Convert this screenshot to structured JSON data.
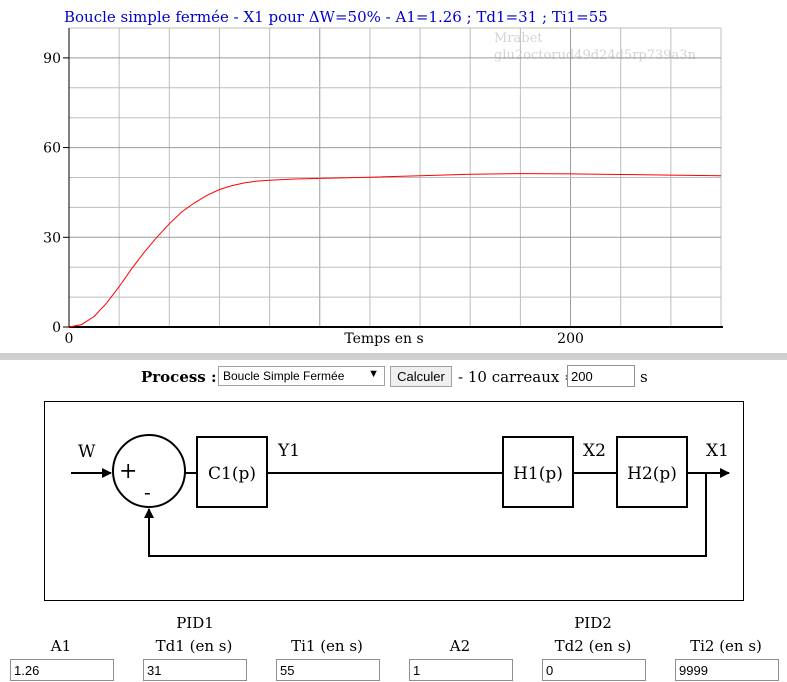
{
  "plot": {
    "title": "Boucle simple fermée - X1 pour ΔW=50% - A1=1.26 ; Td1=31 ; Ti1=55",
    "watermark_line1": "Mrabet",
    "watermark_line2": "glu2octorud49d24d5rp739a3n",
    "x_axis_label": "Temps en s"
  },
  "chart_data": {
    "type": "line",
    "xlim": [
      0,
      260
    ],
    "ylim": [
      0,
      100
    ],
    "x_ticks": [
      0,
      200
    ],
    "x_tick_labels": [
      "0",
      "200"
    ],
    "y_ticks": [
      0,
      30,
      60,
      90
    ],
    "y_tick_labels": [
      "0",
      "30",
      "60",
      "90"
    ],
    "grid": true,
    "xlabel": "Temps en s",
    "series": [
      {
        "color": "#ff0000",
        "x": [
          0,
          5,
          10,
          15,
          20,
          25,
          30,
          35,
          40,
          45,
          50,
          55,
          60,
          65,
          70,
          75,
          80,
          90,
          100,
          120,
          140,
          160,
          180,
          200,
          220,
          240,
          260
        ],
        "y": [
          0,
          0.8,
          3.5,
          8,
          13.5,
          19.5,
          25,
          30,
          34.5,
          38.5,
          41.5,
          44,
          46,
          47.3,
          48.2,
          48.8,
          49.1,
          49.5,
          49.7,
          50.1,
          50.6,
          51.1,
          51.3,
          51.2,
          51.0,
          50.8,
          50.6
        ]
      }
    ]
  },
  "process": {
    "label": "Process :",
    "select_value": "Boucle Simple Fermée",
    "calc_button": "Calculer",
    "carreaux_text": "- 10 carreaux =",
    "span_value": "200",
    "unit": "s"
  },
  "diagram": {
    "W": "W",
    "plus": "+",
    "minus": "-",
    "Y1": "Y1",
    "C1": "C1(p)",
    "H1": "H1(p)",
    "X2": "X2",
    "H2": "H2(p)",
    "X1": "X1"
  },
  "params": {
    "pid1_label": "PID1",
    "pid2_label": "PID2",
    "columns": [
      {
        "label": "A1",
        "value": "1.26"
      },
      {
        "label": "Td1 (en s)",
        "value": "31"
      },
      {
        "label": "Ti1 (en s)",
        "value": "55"
      },
      {
        "label": "A2",
        "value": "1"
      },
      {
        "label": "Td2 (en s)",
        "value": "0"
      },
      {
        "label": "Ti2 (en s)",
        "value": "9999"
      }
    ]
  }
}
